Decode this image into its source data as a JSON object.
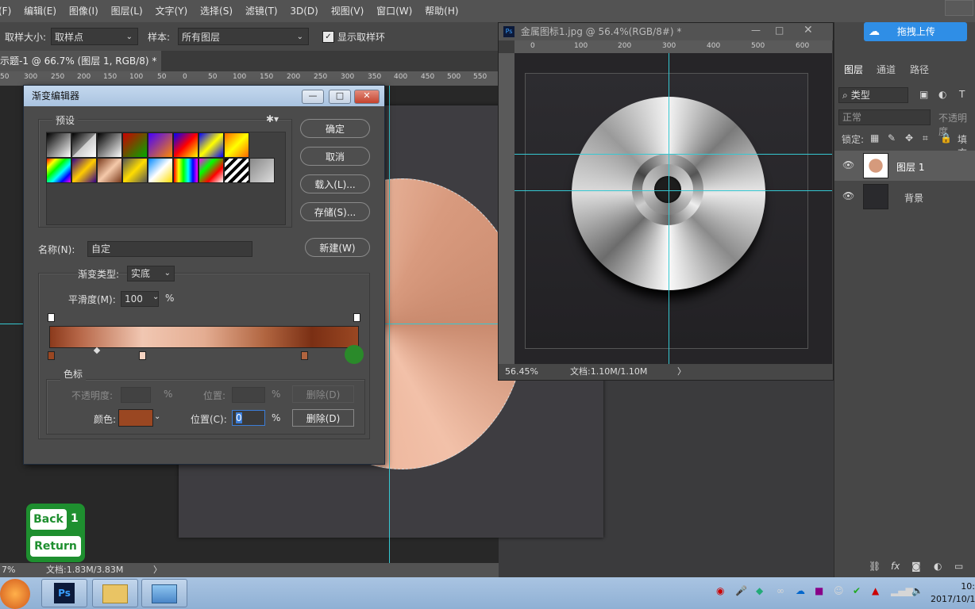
{
  "menu": [
    "(F)",
    "编辑(E)",
    "图像(I)",
    "图层(L)",
    "文字(Y)",
    "选择(S)",
    "滤镜(T)",
    "3D(D)",
    "视图(V)",
    "窗口(W)",
    "帮助(H)"
  ],
  "options": {
    "sample_size_label": "取样大小:",
    "sample_size_value": "取样点",
    "sample_label": "样本:",
    "sample_value": "所有图层",
    "show_ring_label": "显示取样环"
  },
  "doc_tab": {
    "title": "示题-1 @ 66.7% (图层 1, RGB/8) *",
    "close": "×"
  },
  "ruler_ticks": [
    "50",
    "300",
    "250",
    "200",
    "150",
    "100",
    "50",
    "0",
    "50",
    "100",
    "150",
    "200",
    "250",
    "300",
    "350",
    "400",
    "450",
    "500",
    "550"
  ],
  "status_left": {
    "zoom": "7%",
    "doc": "文档:1.83M/3.83M",
    "arrow": "〉"
  },
  "dialog": {
    "title": "渐变编辑器",
    "presets_label": "预设",
    "ok": "确定",
    "cancel": "取消",
    "load": "载入(L)...",
    "save": "存储(S)...",
    "name_label": "名称(N):",
    "name_value": "自定",
    "new": "新建(W)",
    "type_label": "渐变类型:",
    "type_value": "实底",
    "smooth_label": "平滑度(M):",
    "smooth_value": "100",
    "percent": "%",
    "stops_label": "色标",
    "opacity_label": "不透明度:",
    "location_label_dim": "位置:",
    "delete_dim": "删除(D)",
    "color_label": "颜色:",
    "location_label": "位置(C):",
    "location_value": "0",
    "delete": "删除(D)",
    "stop_color": "#9a4722"
  },
  "win2": {
    "title": "金属图标1.jpg @ 56.4%(RGB/8#) *",
    "ruler_h": [
      "0",
      "100",
      "200",
      "300",
      "400",
      "500",
      "600"
    ],
    "zoom": "56.45%",
    "doc": "文档:1.10M/1.10M",
    "arrow": "〉"
  },
  "panel": {
    "upload": "拖拽上传",
    "tabs": [
      "图层",
      "通道",
      "路径"
    ],
    "kind": "类型",
    "blend": "正常",
    "opacity": "不透明度",
    "lock": "锁定:",
    "fill": "填充",
    "layers": [
      "图层 1",
      "背景"
    ]
  },
  "overlay": {
    "back": "Back",
    "num": "1",
    "return": "Return"
  },
  "clock": {
    "time": "10:",
    "date": "2017/10/1"
  },
  "colors": {
    "guide": "#36c8d2",
    "accent": "#2f8ee6",
    "overlay_green": "#1e8f2f"
  }
}
